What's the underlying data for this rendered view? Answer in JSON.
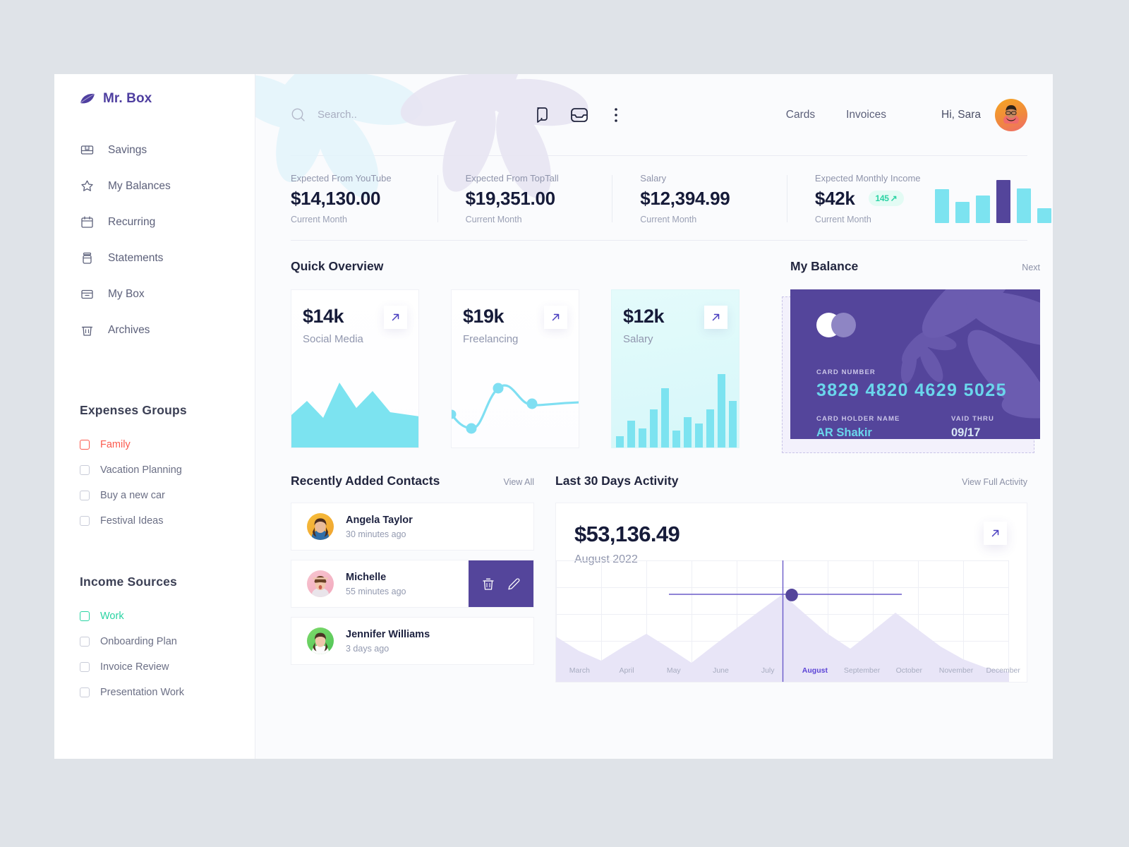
{
  "brand": {
    "name": "Mr. Box",
    "logo_icon": "leaf-icon"
  },
  "sidebar": {
    "nav": [
      {
        "label": "Savings",
        "icon": "savings-box-icon"
      },
      {
        "label": "My Balances",
        "icon": "star-icon"
      },
      {
        "label": "Recurring",
        "icon": "calendar-icon"
      },
      {
        "label": "Statements",
        "icon": "jar-icon"
      },
      {
        "label": "My Box",
        "icon": "box-icon"
      },
      {
        "label": "Archives",
        "icon": "trash-icon"
      }
    ],
    "expenses": {
      "title": "Expenses  Groups",
      "items": [
        {
          "label": "Family",
          "accent": "#fb5a4e",
          "active": true
        },
        {
          "label": "Vacation Planning",
          "accent": "",
          "active": false
        },
        {
          "label": "Buy a new car",
          "accent": "",
          "active": false
        },
        {
          "label": "Festival Ideas",
          "accent": "",
          "active": false
        }
      ]
    },
    "income": {
      "title": "Income Sources",
      "items": [
        {
          "label": "Work",
          "accent": "#29d3a2",
          "active": true
        },
        {
          "label": "Onboarding Plan",
          "accent": "",
          "active": false
        },
        {
          "label": "Invoice Review",
          "accent": "",
          "active": false
        },
        {
          "label": "Presentation Work",
          "accent": "",
          "active": false
        }
      ]
    }
  },
  "header": {
    "search_placeholder": "Search..",
    "search_value": "",
    "icons": [
      {
        "name": "chat-icon"
      },
      {
        "name": "inbox-icon"
      },
      {
        "name": "more-vertical-icon"
      }
    ],
    "links": [
      "Cards",
      "Invoices"
    ],
    "greeting": "Hi, Sara",
    "avatar_name": "user-avatar"
  },
  "stats": [
    {
      "label": "Expected From YouTube",
      "value": "$14,130.00",
      "sub": "Current Month"
    },
    {
      "label": "Expected From TopTall",
      "value": "$19,351.00",
      "sub": "Current Month"
    },
    {
      "label": "Salary",
      "value": "$12,394.99",
      "sub": "Current Month"
    }
  ],
  "income_stat": {
    "label": "Expected Monthly Income",
    "value": "$42k",
    "badge": "145",
    "badge_arrow": "↗",
    "sub": "Current Month"
  },
  "quick_overview": {
    "title": "Quick Overview",
    "cards": [
      {
        "amount": "$14k",
        "name": "Social Media",
        "chart": "area",
        "tint": false
      },
      {
        "amount": "$19k",
        "name": "Freelancing",
        "chart": "line",
        "tint": false
      },
      {
        "amount": "$12k",
        "name": "Salary",
        "chart": "bars",
        "tint": true
      }
    ]
  },
  "balance": {
    "title": "My Balance",
    "next_label": "Next",
    "card": {
      "card_number_label": "CARD NUMBER",
      "card_number": "3829 4820 4629 5025",
      "holder_label": "CARD HOLDER NAME",
      "holder": "AR Shakir",
      "valid_label": "VAID THRU",
      "valid": "09/17"
    }
  },
  "contacts": {
    "title": "Recently Added Contacts",
    "view_all": "View All",
    "items": [
      {
        "name": "Angela Taylor",
        "time": "30 minutes ago",
        "color": "y",
        "actions": false
      },
      {
        "name": "Michelle",
        "time": "55 minutes ago",
        "color": "p",
        "actions": true
      },
      {
        "name": "Jennifer Williams",
        "time": "3 days ago",
        "color": "g",
        "actions": false
      }
    ],
    "delete_icon": "trash-icon",
    "edit_icon": "pencil-icon"
  },
  "activity": {
    "title": "Last 30 Days Activity",
    "view_full": "View Full Activity",
    "amount": "$53,136.49",
    "month": "August 2022"
  },
  "chart_data": [
    {
      "type": "area",
      "title": "Social Media",
      "x": [
        0,
        1,
        2,
        3,
        4,
        5,
        6,
        7
      ],
      "values": [
        38,
        55,
        30,
        92,
        48,
        78,
        40,
        36
      ],
      "ylim": [
        0,
        100
      ],
      "color": "#7ce3f0",
      "grid": false
    },
    {
      "type": "line",
      "title": "Freelancing",
      "x": [
        0,
        1,
        2,
        3,
        4
      ],
      "values": [
        48,
        22,
        30,
        88,
        60
      ],
      "points_marked": [
        1,
        3,
        4
      ],
      "ylim": [
        0,
        100
      ],
      "color": "#7fdff2",
      "grid": false
    },
    {
      "type": "bar",
      "title": "Salary",
      "categories": [
        "1",
        "2",
        "3",
        "4",
        "5",
        "6",
        "7",
        "8",
        "9",
        "10",
        "11"
      ],
      "values": [
        13,
        32,
        23,
        45,
        70,
        20,
        36,
        29,
        45,
        96,
        58
      ],
      "ylim": [
        0,
        100
      ],
      "color": "#7ce3f0",
      "grid": false
    },
    {
      "type": "bar",
      "title": "Expected Monthly Income",
      "categories": [
        "1",
        "2",
        "3",
        "4",
        "5",
        "6"
      ],
      "values": [
        78,
        48,
        62,
        100,
        80,
        33
      ],
      "highlight_index": 3,
      "ylim": [
        0,
        100
      ],
      "color": "#7ce3f0",
      "highlight_color": "#54459b",
      "grid": false
    },
    {
      "type": "area",
      "title": "Last 30 Days Activity",
      "xlabel": "",
      "ylabel": "",
      "categories": [
        "March",
        "April",
        "May",
        "June",
        "July",
        "August",
        "September",
        "October",
        "November",
        "December"
      ],
      "values": [
        46,
        20,
        42,
        16,
        38,
        72,
        26,
        66,
        30,
        12
      ],
      "selected_category": "August",
      "selected_value": 72,
      "annotation": "$53,136.49",
      "ylim": [
        0,
        100
      ],
      "color": "#e5e2f7",
      "grid": true,
      "legend": "none"
    }
  ]
}
